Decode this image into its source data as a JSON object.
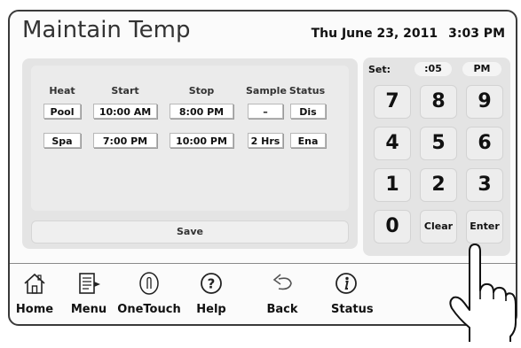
{
  "header": {
    "title": "Maintain Temp",
    "date": "Thu June 23, 2011",
    "time": "3:03 PM"
  },
  "schedule": {
    "columns": [
      "Heat",
      "Start",
      "Stop",
      "Sample",
      "Status"
    ],
    "rows": [
      {
        "heat": "Pool",
        "start": "10:00 AM",
        "stop": "8:00 PM",
        "sample": "–",
        "status": "Dis"
      },
      {
        "heat": "Spa",
        "start": "7:00 PM",
        "stop": "10:00 PM",
        "sample": "2 Hrs",
        "status": "Ena"
      }
    ],
    "save_label": "Save"
  },
  "keypad": {
    "set_label": "Set:",
    "set_value": ":05",
    "set_period": "PM",
    "keys": [
      "7",
      "8",
      "9",
      "4",
      "5",
      "6",
      "1",
      "2",
      "3",
      "0",
      "Clear",
      "Enter"
    ]
  },
  "nav": {
    "items": [
      {
        "label": "Home",
        "icon": "home-icon"
      },
      {
        "label": "Menu",
        "icon": "menu-icon"
      },
      {
        "label": "OneTouch",
        "icon": "onetouch-icon"
      },
      {
        "label": "Help",
        "icon": "help-icon"
      },
      {
        "label": "Back",
        "icon": "back-icon"
      },
      {
        "label": "Status",
        "icon": "status-icon"
      }
    ]
  },
  "colors": {
    "panel_bg": "#e4e4e4",
    "frame": "#3a3a3a",
    "button_bg": "#ffffff"
  }
}
